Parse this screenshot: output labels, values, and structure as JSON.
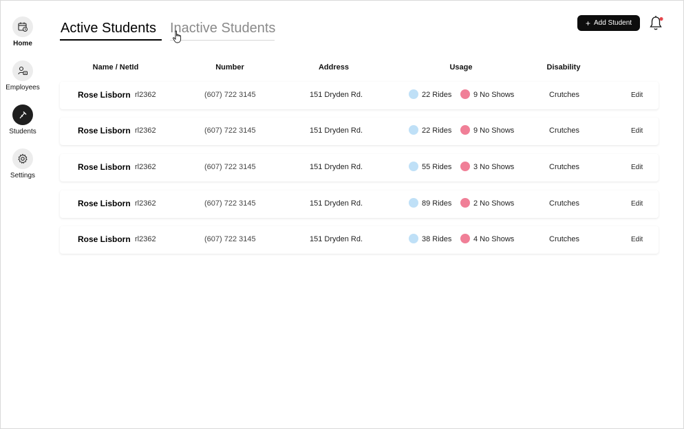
{
  "sidebar": {
    "items": [
      {
        "label": "Home",
        "icon": "calendar-icon",
        "active": false
      },
      {
        "label": "Employees",
        "icon": "employee-badge-icon",
        "active": false
      },
      {
        "label": "Students",
        "icon": "crutch-icon",
        "active": true
      },
      {
        "label": "Settings",
        "icon": "gear-icon",
        "active": false
      }
    ]
  },
  "tabs": {
    "active": "Active Students",
    "inactive": "Inactive Students"
  },
  "header": {
    "add_button": "Add Student",
    "add_icon": "+",
    "notification_icon": "bell-icon",
    "notification_dot_color": "#e5484d"
  },
  "table": {
    "columns": [
      "Name / NetId",
      "Number",
      "Address",
      "Usage",
      "Disability"
    ],
    "rows": [
      {
        "name": "Rose Lisborn",
        "netid": "rl2362",
        "number": "(607) 722 3145",
        "address": "151 Dryden Rd.",
        "rides": "22 Rides",
        "no_shows": "9 No Shows",
        "disability": "Crutches",
        "action": "Edit"
      },
      {
        "name": "Rose Lisborn",
        "netid": "rl2362",
        "number": "(607) 722 3145",
        "address": "151 Dryden Rd.",
        "rides": "22 Rides",
        "no_shows": "9 No Shows",
        "disability": "Crutches",
        "action": "Edit"
      },
      {
        "name": "Rose Lisborn",
        "netid": "rl2362",
        "number": "(607) 722 3145",
        "address": "151 Dryden Rd.",
        "rides": "55 Rides",
        "no_shows": "3 No Shows",
        "disability": "Crutches",
        "action": "Edit"
      },
      {
        "name": "Rose Lisborn",
        "netid": "rl2362",
        "number": "(607) 722 3145",
        "address": "151 Dryden Rd.",
        "rides": "89 Rides",
        "no_shows": "2 No Shows",
        "disability": "Crutches",
        "action": "Edit"
      },
      {
        "name": "Rose Lisborn",
        "netid": "rl2362",
        "number": "(607) 722 3145",
        "address": "151 Dryden Rd.",
        "rides": "38 Rides",
        "no_shows": "4 No Shows",
        "disability": "Crutches",
        "action": "Edit"
      }
    ]
  },
  "colors": {
    "rides_dot": "#bfe0f7",
    "no_shows_dot": "#f07f97",
    "primary": "#0d0d0d"
  }
}
